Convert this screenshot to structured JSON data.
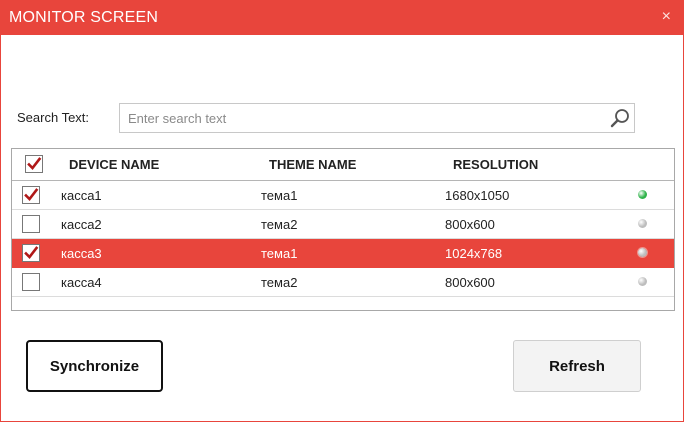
{
  "window": {
    "title": "MONITOR SCREEN",
    "close_glyph": "×"
  },
  "search": {
    "label": "Search Text:",
    "placeholder": "Enter search text",
    "value": ""
  },
  "grid": {
    "header_checked": true,
    "columns": [
      "DEVICE NAME",
      "THEME NAME",
      "RESOLUTION"
    ],
    "rows": [
      {
        "checked": true,
        "device": "касса1",
        "theme": "тема1",
        "resolution": "1680x1050",
        "status": "online",
        "selected": false
      },
      {
        "checked": false,
        "device": "касса2",
        "theme": "тема2",
        "resolution": "800x600",
        "status": "offline",
        "selected": false
      },
      {
        "checked": true,
        "device": "касса3",
        "theme": "тема1",
        "resolution": "1024x768",
        "status": "offline",
        "selected": true
      },
      {
        "checked": false,
        "device": "касса4",
        "theme": "тема2",
        "resolution": "800x600",
        "status": "offline",
        "selected": false
      }
    ]
  },
  "buttons": {
    "synchronize": "Synchronize",
    "refresh": "Refresh"
  },
  "colors": {
    "accent": "#e8453c",
    "check": "#b01818",
    "status_online": "#2fb34a",
    "status_offline": "#bdbdbd"
  },
  "icons": {
    "search": "magnifier-icon",
    "close": "close-icon",
    "check": "checkmark-icon",
    "status": "status-dot-icon"
  }
}
